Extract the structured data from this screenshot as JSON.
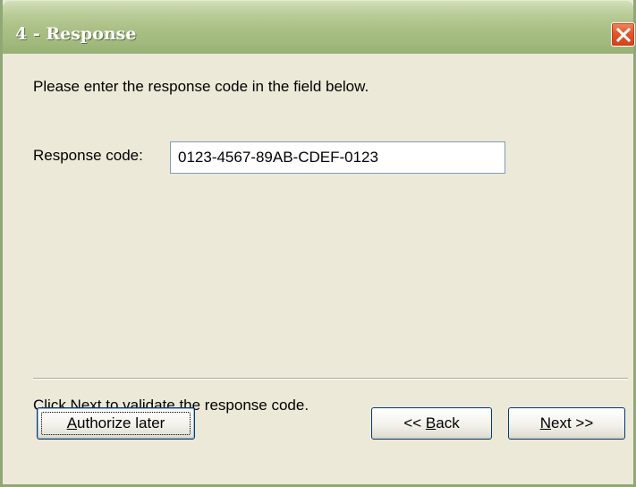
{
  "window": {
    "title": "4 - Response",
    "close_icon": "close-icon",
    "accent_color": "#a9bf84",
    "close_color": "#e3562d"
  },
  "content": {
    "instruction": "Please enter the response code in the field below.",
    "response_label": "Response code:",
    "response_value": "0123-4567-89AB-CDEF-0123",
    "response_placeholder": "",
    "footer_text": "Click Next to validate the response code."
  },
  "buttons": {
    "authorize_later": {
      "underline": "A",
      "rest": "uthorize later"
    },
    "back": {
      "prefix": "<< ",
      "underline": "B",
      "rest": "ack"
    },
    "next": {
      "underline": "N",
      "rest": "ext >>"
    }
  }
}
